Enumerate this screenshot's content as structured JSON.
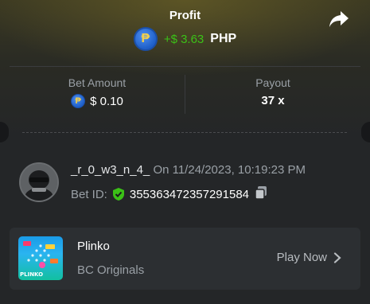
{
  "header": {
    "title": "Profit",
    "profit_amount": "+$ 3.63",
    "currency": "PHP",
    "currency_symbol": "₱"
  },
  "stats": {
    "bet_amount_label": "Bet Amount",
    "bet_amount_value": "$ 0.10",
    "payout_label": "Payout",
    "payout_value": "37 x"
  },
  "bet": {
    "username": "_r_0_w3_n_4_",
    "date": "On 11/24/2023, 10:19:23 PM",
    "bet_id_label": "Bet ID:",
    "bet_id": "355363472357291584"
  },
  "game": {
    "name": "Plinko",
    "provider": "BC Originals",
    "thumb_label": "PLINKO",
    "play_label": "Play Now"
  },
  "colors": {
    "profit_green": "#3bc117",
    "background": "#242628",
    "card": "#2c2f32",
    "muted_text": "#9aa0a6"
  }
}
